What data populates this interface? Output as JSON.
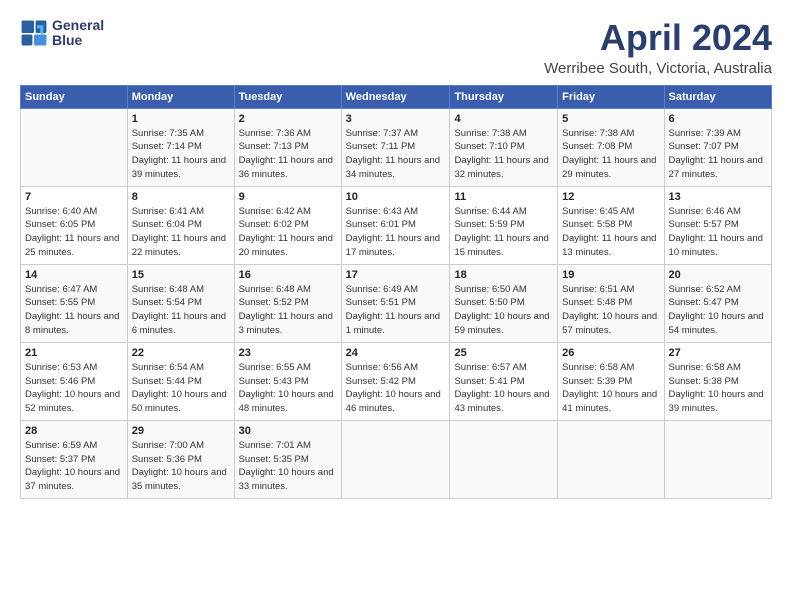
{
  "header": {
    "logo_line1": "General",
    "logo_line2": "Blue",
    "title": "April 2024",
    "location": "Werribee South, Victoria, Australia"
  },
  "columns": [
    "Sunday",
    "Monday",
    "Tuesday",
    "Wednesday",
    "Thursday",
    "Friday",
    "Saturday"
  ],
  "weeks": [
    [
      {
        "day": "",
        "detail": ""
      },
      {
        "day": "1",
        "detail": "Sunrise: 7:35 AM\nSunset: 7:14 PM\nDaylight: 11 hours\nand 39 minutes."
      },
      {
        "day": "2",
        "detail": "Sunrise: 7:36 AM\nSunset: 7:13 PM\nDaylight: 11 hours\nand 36 minutes."
      },
      {
        "day": "3",
        "detail": "Sunrise: 7:37 AM\nSunset: 7:11 PM\nDaylight: 11 hours\nand 34 minutes."
      },
      {
        "day": "4",
        "detail": "Sunrise: 7:38 AM\nSunset: 7:10 PM\nDaylight: 11 hours\nand 32 minutes."
      },
      {
        "day": "5",
        "detail": "Sunrise: 7:38 AM\nSunset: 7:08 PM\nDaylight: 11 hours\nand 29 minutes."
      },
      {
        "day": "6",
        "detail": "Sunrise: 7:39 AM\nSunset: 7:07 PM\nDaylight: 11 hours\nand 27 minutes."
      }
    ],
    [
      {
        "day": "7",
        "detail": "Sunrise: 6:40 AM\nSunset: 6:05 PM\nDaylight: 11 hours\nand 25 minutes."
      },
      {
        "day": "8",
        "detail": "Sunrise: 6:41 AM\nSunset: 6:04 PM\nDaylight: 11 hours\nand 22 minutes."
      },
      {
        "day": "9",
        "detail": "Sunrise: 6:42 AM\nSunset: 6:02 PM\nDaylight: 11 hours\nand 20 minutes."
      },
      {
        "day": "10",
        "detail": "Sunrise: 6:43 AM\nSunset: 6:01 PM\nDaylight: 11 hours\nand 17 minutes."
      },
      {
        "day": "11",
        "detail": "Sunrise: 6:44 AM\nSunset: 5:59 PM\nDaylight: 11 hours\nand 15 minutes."
      },
      {
        "day": "12",
        "detail": "Sunrise: 6:45 AM\nSunset: 5:58 PM\nDaylight: 11 hours\nand 13 minutes."
      },
      {
        "day": "13",
        "detail": "Sunrise: 6:46 AM\nSunset: 5:57 PM\nDaylight: 11 hours\nand 10 minutes."
      }
    ],
    [
      {
        "day": "14",
        "detail": "Sunrise: 6:47 AM\nSunset: 5:55 PM\nDaylight: 11 hours\nand 8 minutes."
      },
      {
        "day": "15",
        "detail": "Sunrise: 6:48 AM\nSunset: 5:54 PM\nDaylight: 11 hours\nand 6 minutes."
      },
      {
        "day": "16",
        "detail": "Sunrise: 6:48 AM\nSunset: 5:52 PM\nDaylight: 11 hours\nand 3 minutes."
      },
      {
        "day": "17",
        "detail": "Sunrise: 6:49 AM\nSunset: 5:51 PM\nDaylight: 11 hours\nand 1 minute."
      },
      {
        "day": "18",
        "detail": "Sunrise: 6:50 AM\nSunset: 5:50 PM\nDaylight: 10 hours\nand 59 minutes."
      },
      {
        "day": "19",
        "detail": "Sunrise: 6:51 AM\nSunset: 5:48 PM\nDaylight: 10 hours\nand 57 minutes."
      },
      {
        "day": "20",
        "detail": "Sunrise: 6:52 AM\nSunset: 5:47 PM\nDaylight: 10 hours\nand 54 minutes."
      }
    ],
    [
      {
        "day": "21",
        "detail": "Sunrise: 6:53 AM\nSunset: 5:46 PM\nDaylight: 10 hours\nand 52 minutes."
      },
      {
        "day": "22",
        "detail": "Sunrise: 6:54 AM\nSunset: 5:44 PM\nDaylight: 10 hours\nand 50 minutes."
      },
      {
        "day": "23",
        "detail": "Sunrise: 6:55 AM\nSunset: 5:43 PM\nDaylight: 10 hours\nand 48 minutes."
      },
      {
        "day": "24",
        "detail": "Sunrise: 6:56 AM\nSunset: 5:42 PM\nDaylight: 10 hours\nand 46 minutes."
      },
      {
        "day": "25",
        "detail": "Sunrise: 6:57 AM\nSunset: 5:41 PM\nDaylight: 10 hours\nand 43 minutes."
      },
      {
        "day": "26",
        "detail": "Sunrise: 6:58 AM\nSunset: 5:39 PM\nDaylight: 10 hours\nand 41 minutes."
      },
      {
        "day": "27",
        "detail": "Sunrise: 6:58 AM\nSunset: 5:38 PM\nDaylight: 10 hours\nand 39 minutes."
      }
    ],
    [
      {
        "day": "28",
        "detail": "Sunrise: 6:59 AM\nSunset: 5:37 PM\nDaylight: 10 hours\nand 37 minutes."
      },
      {
        "day": "29",
        "detail": "Sunrise: 7:00 AM\nSunset: 5:36 PM\nDaylight: 10 hours\nand 35 minutes."
      },
      {
        "day": "30",
        "detail": "Sunrise: 7:01 AM\nSunset: 5:35 PM\nDaylight: 10 hours\nand 33 minutes."
      },
      {
        "day": "",
        "detail": ""
      },
      {
        "day": "",
        "detail": ""
      },
      {
        "day": "",
        "detail": ""
      },
      {
        "day": "",
        "detail": ""
      }
    ]
  ]
}
